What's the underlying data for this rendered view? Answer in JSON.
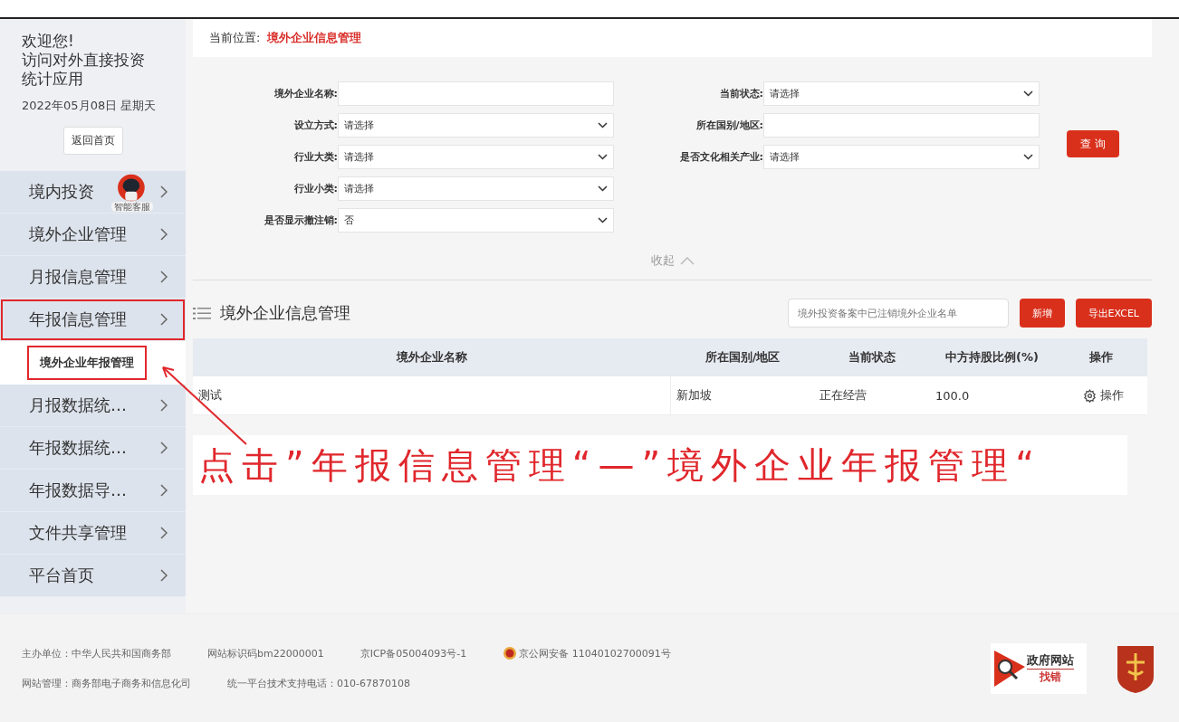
{
  "sidebar": {
    "welcome": "欢迎您!",
    "app_name": "访问对外直接投资统计应用",
    "date": "2022年05月08日 星期天",
    "home_button": "返回首页",
    "assistant_label": "智能客服",
    "items": [
      {
        "label": "境内投资",
        "highlighted": false
      },
      {
        "label": "境外企业管理",
        "highlighted": false
      },
      {
        "label": "月报信息管理",
        "highlighted": false
      },
      {
        "label": "年报信息管理",
        "highlighted": true,
        "expanded": true,
        "children": [
          {
            "label": "境外企业年报管理",
            "highlighted": true
          }
        ]
      },
      {
        "label": "月报数据统…",
        "highlighted": false
      },
      {
        "label": "年报数据统…",
        "highlighted": false
      },
      {
        "label": "年报数据导…",
        "highlighted": false
      },
      {
        "label": "文件共享管理",
        "highlighted": false
      },
      {
        "label": "平台首页",
        "highlighted": false
      }
    ]
  },
  "breadcrumb": {
    "label": "当前位置:",
    "current": "境外企业信息管理"
  },
  "filters": {
    "left": [
      {
        "label": "境外企业名称:",
        "kind": "text"
      },
      {
        "label": "设立方式:",
        "kind": "select",
        "value": "请选择"
      },
      {
        "label": "行业大类:",
        "kind": "select",
        "value": "请选择"
      },
      {
        "label": "行业小类:",
        "kind": "select",
        "value": "请选择"
      },
      {
        "label": "是否显示撤注销:",
        "kind": "select",
        "value": "否"
      }
    ],
    "right": [
      {
        "label": "当前状态:",
        "kind": "select",
        "value": "请选择"
      },
      {
        "label": "所在国别/地区:",
        "kind": "text"
      },
      {
        "label": "是否文化相关产业:",
        "kind": "select",
        "value": "请选择"
      }
    ],
    "query_button": "查 询",
    "collapse": "收起"
  },
  "list": {
    "title": "境外企业信息管理",
    "search": {
      "placeholder": "境外投资备案中已注销境外企业名单"
    },
    "buttons": [
      "新增",
      "导出EXCEL"
    ],
    "columns": [
      "境外企业名称",
      "所在国别/地区",
      "当前状态",
      "中方持股比例(%)",
      "操作"
    ],
    "rows": [
      {
        "cells": [
          "测试",
          "新加坡",
          "正在经营",
          "100.0"
        ],
        "action": "操作"
      }
    ]
  },
  "annotation": {
    "caption": "点击”年报信息管理“—”境外企业年报管理“"
  },
  "footer": {
    "lines": [
      [
        {
          "text": "主办单位：中华人民共和国商务部"
        },
        {
          "text": "网站标识码bm22000001"
        },
        {
          "text": "京ICP备05004093号-1"
        },
        {
          "text": "京公网安备 11040102700091号",
          "badge": true
        }
      ],
      [
        {
          "text": "网站管理：商务部电子商务和信息化司"
        },
        {
          "text": "统一平台技术支持电话：010-67870108"
        }
      ]
    ],
    "report_logo": {
      "title": "政府网站",
      "subtitle": "找错"
    }
  }
}
